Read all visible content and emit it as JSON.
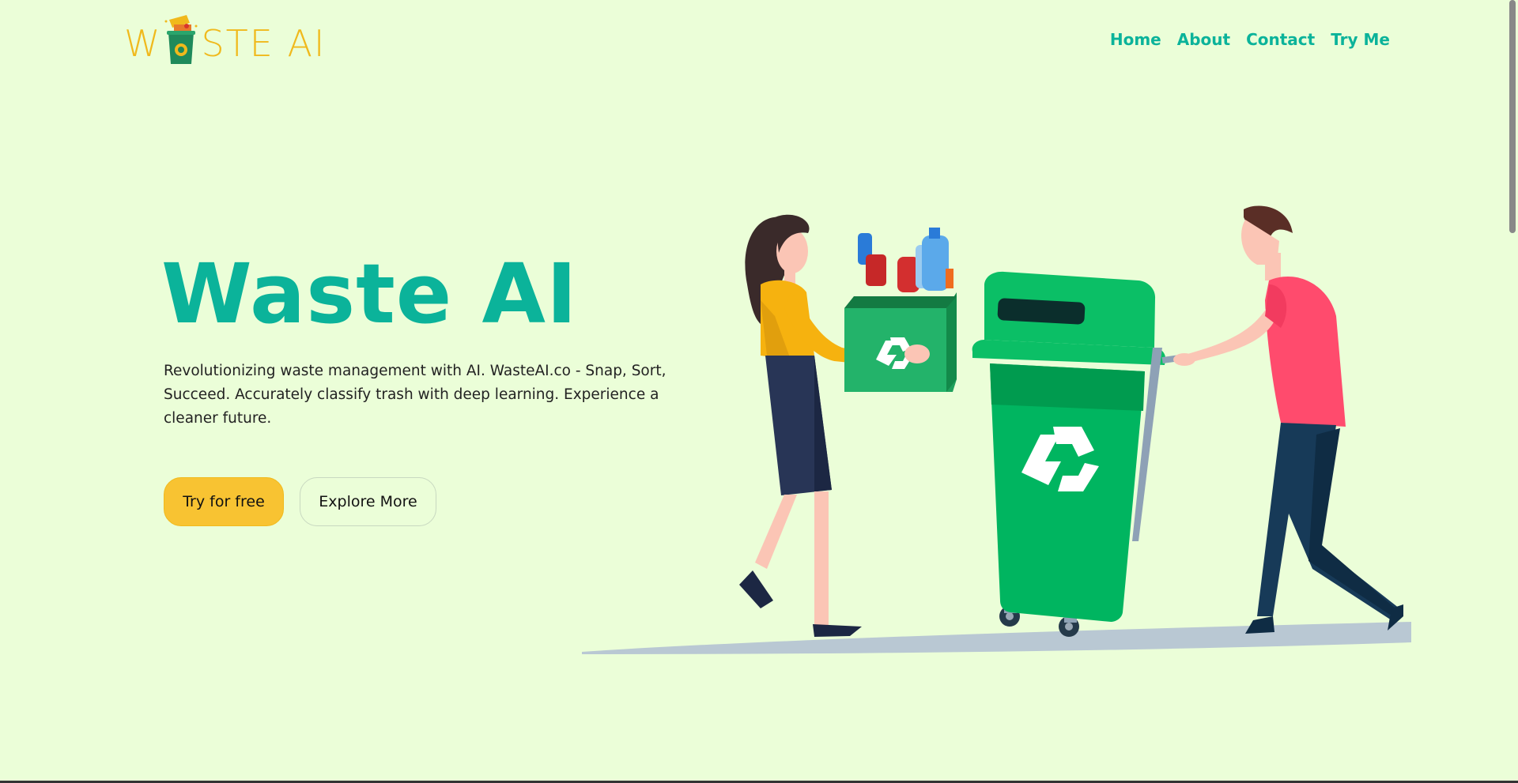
{
  "brand": {
    "logo_prefix": "W",
    "logo_suffix": "STE AI",
    "logo_alt": "A",
    "accent_color": "#0bb39a",
    "logo_color": "#f0b91c",
    "background_color": "#ebfed8"
  },
  "nav": {
    "items": [
      {
        "label": "Home"
      },
      {
        "label": "About"
      },
      {
        "label": "Contact"
      },
      {
        "label": "Try Me"
      }
    ]
  },
  "hero": {
    "title": "Waste AI",
    "description": "Revolutionizing waste management with AI. WasteAI.co - Snap, Sort, Succeed. Accurately classify trash with deep learning. Experience a cleaner future.",
    "primary_button": "Try for free",
    "secondary_button": "Explore More"
  },
  "illustration": {
    "icons": [
      "recycle-icon",
      "trash-bin-icon",
      "plastic-bottle-icon"
    ]
  }
}
